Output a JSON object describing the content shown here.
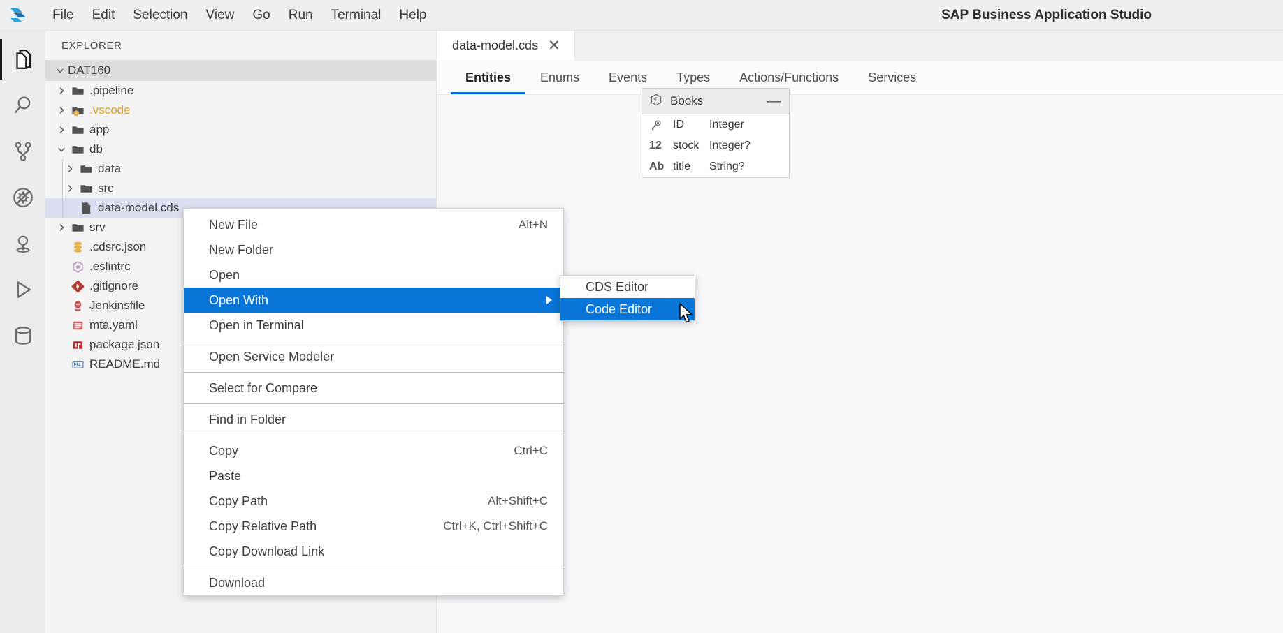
{
  "app": {
    "title": "SAP Business Application Studio",
    "logo_icon": "sap-logo-icon"
  },
  "menubar": {
    "items": [
      {
        "label": "File"
      },
      {
        "label": "Edit"
      },
      {
        "label": "Selection"
      },
      {
        "label": "View"
      },
      {
        "label": "Go"
      },
      {
        "label": "Run"
      },
      {
        "label": "Terminal"
      },
      {
        "label": "Help"
      }
    ]
  },
  "activitybar": {
    "items": [
      {
        "name": "explorer-icon",
        "active": true
      },
      {
        "name": "search-icon",
        "active": false
      },
      {
        "name": "source-control-icon",
        "active": false
      },
      {
        "name": "run-and-debug-icon",
        "active": false
      },
      {
        "name": "extensions-lightbulb-icon",
        "active": false
      },
      {
        "name": "run-play-icon",
        "active": false
      },
      {
        "name": "database-icon",
        "active": false
      }
    ]
  },
  "explorer": {
    "title": "EXPLORER",
    "root": {
      "label": "DAT160",
      "expanded": true
    },
    "tree": [
      {
        "label": ".pipeline",
        "type": "folder",
        "expanded": false,
        "depth": 1,
        "icon": "folder-icon"
      },
      {
        "label": ".vscode",
        "type": "folder",
        "expanded": false,
        "depth": 1,
        "icon": "folder-warning-icon",
        "warning": true
      },
      {
        "label": "app",
        "type": "folder",
        "expanded": false,
        "depth": 1,
        "icon": "folder-icon"
      },
      {
        "label": "db",
        "type": "folder",
        "expanded": true,
        "depth": 1,
        "icon": "folder-icon"
      },
      {
        "label": "data",
        "type": "folder",
        "expanded": false,
        "depth": 2,
        "icon": "folder-icon"
      },
      {
        "label": "src",
        "type": "folder",
        "expanded": false,
        "depth": 2,
        "icon": "folder-icon"
      },
      {
        "label": "data-model.cds",
        "type": "file",
        "depth": 2,
        "icon": "cds-file-icon",
        "selected": true
      },
      {
        "label": "srv",
        "type": "folder",
        "expanded": false,
        "depth": 1,
        "icon": "folder-icon"
      },
      {
        "label": ".cdsrc.json",
        "type": "file",
        "depth": 1,
        "icon": "json-db-icon"
      },
      {
        "label": ".eslintrc",
        "type": "file",
        "depth": 1,
        "icon": "eslint-icon"
      },
      {
        "label": ".gitignore",
        "type": "file",
        "depth": 1,
        "icon": "git-icon"
      },
      {
        "label": "Jenkinsfile",
        "type": "file",
        "depth": 1,
        "icon": "jenkins-icon"
      },
      {
        "label": "mta.yaml",
        "type": "file",
        "depth": 1,
        "icon": "yaml-icon"
      },
      {
        "label": "package.json",
        "type": "file",
        "depth": 1,
        "icon": "npm-icon"
      },
      {
        "label": "README.md",
        "type": "file",
        "depth": 1,
        "icon": "markdown-icon"
      }
    ]
  },
  "editor": {
    "tabs": [
      {
        "label": "data-model.cds",
        "close_icon": "close-icon",
        "active": true
      }
    ],
    "subtabs": [
      {
        "label": "Entities",
        "active": true
      },
      {
        "label": "Enums",
        "active": false
      },
      {
        "label": "Events",
        "active": false
      },
      {
        "label": "Types",
        "active": false
      },
      {
        "label": "Actions/Functions",
        "active": false
      },
      {
        "label": "Services",
        "active": false
      }
    ],
    "entity": {
      "name": "Books",
      "header_icon": "entity-cube-icon",
      "collapse_label": "—",
      "fields": [
        {
          "icon_label": "",
          "icon_name": "key-icon",
          "field": "ID",
          "type": "Integer"
        },
        {
          "icon_label": "12",
          "icon_name": "number-icon",
          "field": "stock",
          "type": "Integer?"
        },
        {
          "icon_label": "Ab",
          "icon_name": "text-icon",
          "field": "title",
          "type": "String?"
        }
      ]
    }
  },
  "context_menu": {
    "items": [
      {
        "label": "New File",
        "shortcut": "Alt+N",
        "highlight": false,
        "submenu": false
      },
      {
        "label": "New Folder",
        "shortcut": "",
        "highlight": false,
        "submenu": false
      },
      {
        "label": "Open",
        "shortcut": "",
        "highlight": false,
        "submenu": false
      },
      {
        "label": "Open With",
        "shortcut": "",
        "highlight": true,
        "submenu": true
      },
      {
        "label": "Open in Terminal",
        "shortcut": "",
        "highlight": false,
        "submenu": false
      },
      {
        "separator": true
      },
      {
        "label": "Open Service Modeler",
        "shortcut": "",
        "highlight": false,
        "submenu": false
      },
      {
        "separator": true
      },
      {
        "label": "Select for Compare",
        "shortcut": "",
        "highlight": false,
        "submenu": false
      },
      {
        "separator": true
      },
      {
        "label": "Find in Folder",
        "shortcut": "",
        "highlight": false,
        "submenu": false
      },
      {
        "separator": true
      },
      {
        "label": "Copy",
        "shortcut": "Ctrl+C",
        "highlight": false,
        "submenu": false
      },
      {
        "label": "Paste",
        "shortcut": "",
        "highlight": false,
        "submenu": false
      },
      {
        "label": "Copy Path",
        "shortcut": "Alt+Shift+C",
        "highlight": false,
        "submenu": false
      },
      {
        "label": "Copy Relative Path",
        "shortcut": "Ctrl+K, Ctrl+Shift+C",
        "highlight": false,
        "submenu": false
      },
      {
        "label": "Copy Download Link",
        "shortcut": "",
        "highlight": false,
        "submenu": false
      },
      {
        "separator": true
      },
      {
        "label": "Download",
        "shortcut": "",
        "highlight": false,
        "submenu": false
      }
    ]
  },
  "submenu": {
    "items": [
      {
        "label": "CDS Editor",
        "highlight": false
      },
      {
        "label": "Code Editor",
        "highlight": true
      }
    ]
  },
  "cursor": {
    "name": "mouse-pointer-icon"
  },
  "colors": {
    "accent": "#0a75d8",
    "warning": "#e8a33d",
    "menubar_bg": "#edeff0",
    "explorer_bg": "#f3f3f3",
    "selection_bg": "#dcdff0"
  }
}
